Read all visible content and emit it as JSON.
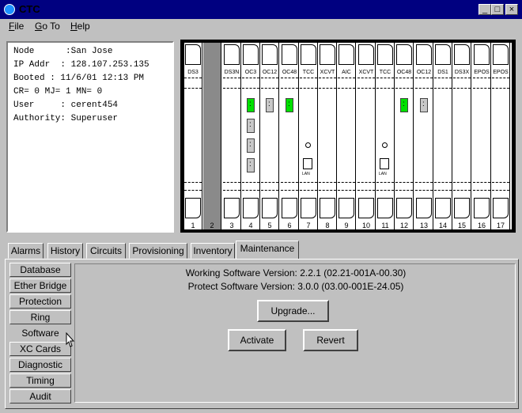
{
  "window": {
    "title": "CTC",
    "min": "_",
    "max": "□",
    "close": "×"
  },
  "menu": [
    {
      "key": "file",
      "label": "File",
      "mnemonic": "F",
      "rest": "ile"
    },
    {
      "key": "goto",
      "label": "Go To",
      "mnemonic": "G",
      "rest": "o To"
    },
    {
      "key": "help",
      "label": "Help",
      "mnemonic": "H",
      "rest": "elp"
    }
  ],
  "node_info": {
    "lines": [
      "Node      :San Jose",
      "IP Addr  : 128.107.253.135",
      "Booted : 11/6/01 12:13 PM",
      "CR= 0 MJ= 1 MN= 0",
      "User     : cerent454",
      "Authority: Superuser"
    ]
  },
  "shelf": {
    "slots": [
      {
        "num": "1",
        "card": "DS3"
      },
      {
        "num": "2",
        "card": ""
      },
      {
        "num": "3",
        "card": "DS3N"
      },
      {
        "num": "4",
        "card": "OC3"
      },
      {
        "num": "5",
        "card": "OC12"
      },
      {
        "num": "6",
        "card": "OC48"
      },
      {
        "num": "7",
        "card": "TCC"
      },
      {
        "num": "8",
        "card": "XCVT"
      },
      {
        "num": "9",
        "card": "AIC"
      },
      {
        "num": "10",
        "card": "XCVT"
      },
      {
        "num": "11",
        "card": "TCC"
      },
      {
        "num": "12",
        "card": "OC48"
      },
      {
        "num": "13",
        "card": "OC12"
      },
      {
        "num": "14",
        "card": "DS1"
      },
      {
        "num": "15",
        "card": "DS3X"
      },
      {
        "num": "16",
        "card": "EPOS"
      },
      {
        "num": "17",
        "card": "EPOS"
      }
    ],
    "lan_label": "LAN",
    "led_colors": {
      "green": "#00e000",
      "gray": "#c8c8c8"
    }
  },
  "tabs": [
    "Alarms",
    "History",
    "Circuits",
    "Provisioning",
    "Inventory",
    "Maintenance"
  ],
  "active_tab": "Maintenance",
  "maintenance_buttons": [
    "Database",
    "Ether Bridge",
    "Protection",
    "Ring",
    "Software",
    "XC Cards",
    "Diagnostic",
    "Timing",
    "Audit"
  ],
  "selected_button": "Software",
  "software": {
    "working": "Working Software Version: 2.2.1 (02.21-001A-00.30)",
    "protect": "Protect Software Version: 3.0.0 (03.00-001E-24.05)",
    "upgrade_label": "Upgrade...",
    "activate_label": "Activate",
    "revert_label": "Revert"
  }
}
